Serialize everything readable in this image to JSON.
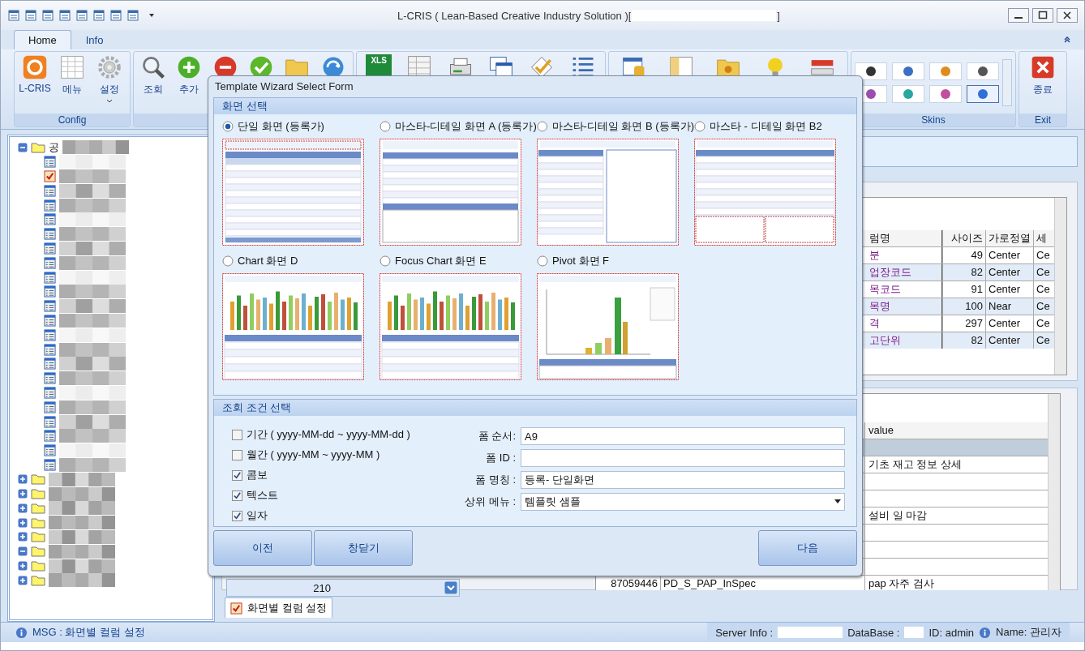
{
  "window": {
    "title": "L-CRIS ( Lean-Based Creative Industry Solution )[",
    "title_end": "]"
  },
  "tabs": [
    {
      "label": "Home",
      "selected": true
    },
    {
      "label": "Info",
      "selected": false
    }
  ],
  "ribbon": {
    "groups": [
      {
        "label": "Config",
        "buttons": [
          {
            "kind": "logo",
            "label": "L-CRIS"
          },
          {
            "kind": "grid",
            "label": "메뉴"
          },
          {
            "kind": "gear",
            "label": "설정",
            "caret": true
          }
        ]
      },
      {
        "buttons": [
          {
            "kind": "search",
            "label": "조회"
          },
          {
            "kind": "add",
            "label": "추가"
          },
          {
            "kind": "delete"
          },
          {
            "kind": "confirm"
          },
          {
            "kind": "folder"
          },
          {
            "kind": "refresh"
          }
        ]
      },
      {
        "buttons": [
          {
            "kind": "xls",
            "label": "XLS"
          },
          {
            "kind": "table"
          },
          {
            "kind": "printer"
          },
          {
            "kind": "windows"
          },
          {
            "kind": "check"
          },
          {
            "kind": "list"
          }
        ]
      },
      {
        "buttons": [
          {
            "kind": "window-db"
          },
          {
            "kind": "window2"
          },
          {
            "kind": "folder-star"
          },
          {
            "kind": "bulb"
          },
          {
            "kind": "toggle"
          }
        ]
      }
    ],
    "skins": {
      "label": "Skins",
      "items": [
        {
          "color": "#333333",
          "selected": false
        },
        {
          "color": "#3a6fc4",
          "selected": false
        },
        {
          "color": "#e08a1e",
          "selected": false
        },
        {
          "color": "#555555",
          "selected": false
        },
        {
          "color": "#9a4fb0",
          "selected": false
        },
        {
          "color": "#2aa6a0",
          "selected": false
        },
        {
          "color": "#c04fa0",
          "selected": false
        },
        {
          "color": "#2f6fd6",
          "selected": true
        }
      ]
    },
    "exit": {
      "label": "Exit",
      "button": "종료"
    }
  },
  "tree": [
    {
      "label": "공",
      "expanded": true,
      "children": [
        {
          "kind": "form"
        },
        {
          "kind": "checked"
        },
        {
          "kind": "form"
        },
        {
          "kind": "form"
        },
        {
          "kind": "form"
        },
        {
          "kind": "form"
        },
        {
          "kind": "form"
        },
        {
          "kind": "form"
        },
        {
          "kind": "form"
        },
        {
          "kind": "form"
        },
        {
          "kind": "form"
        },
        {
          "kind": "form"
        },
        {
          "kind": "form"
        },
        {
          "kind": "form"
        },
        {
          "kind": "form"
        },
        {
          "kind": "form"
        },
        {
          "kind": "form"
        },
        {
          "kind": "form"
        },
        {
          "kind": "form"
        },
        {
          "kind": "form"
        },
        {
          "kind": "form"
        },
        {
          "kind": "form"
        }
      ]
    },
    {
      "expanded": false
    },
    {
      "expanded": false
    },
    {
      "expanded": false
    },
    {
      "expanded": false
    },
    {
      "expanded": false
    },
    {
      "expanded": true
    },
    {
      "expanded": false
    },
    {
      "expanded": false
    }
  ],
  "column_grid": {
    "columns": [
      "럼명",
      "사이즈",
      "가로정열",
      "세"
    ],
    "rows": [
      {
        "cells": [
          "분",
          "49",
          "Center",
          "Ce"
        ],
        "selected": false
      },
      {
        "cells": [
          "업장코드",
          "82",
          "Center",
          "Ce"
        ],
        "selected": true
      },
      {
        "cells": [
          "목코드",
          "91",
          "Center",
          "Ce"
        ],
        "selected": false
      },
      {
        "cells": [
          "목명",
          "100",
          "Near",
          "Ce"
        ],
        "selected": true
      },
      {
        "cells": [
          "격",
          "297",
          "Center",
          "Ce"
        ],
        "selected": false
      },
      {
        "cells": [
          "고단위",
          "82",
          "Center",
          "Ce"
        ],
        "selected": true
      }
    ]
  },
  "value_grid": {
    "header": "value",
    "rows": [
      {
        "value": "",
        "selected": true
      },
      {
        "value": "기초 재고 정보 상세",
        "selected": false
      },
      {
        "value": "",
        "selected": false
      },
      {
        "value": "",
        "selected": false
      },
      {
        "value": "설비 일 마감",
        "selected": false
      },
      {
        "value": "",
        "selected": false
      },
      {
        "value": "",
        "selected": false
      },
      {
        "value": "",
        "selected": false
      }
    ],
    "last_row": {
      "number": "87059446",
      "name": "PD_S_PAP_InSpec",
      "value": "pap 자주 검사"
    }
  },
  "width_field": {
    "value": "210"
  },
  "bottom_tab": {
    "label": "화면별 컬럼 설정",
    "checked": true
  },
  "dialog": {
    "title": "Template Wizard Select Form",
    "screen_section": "화면 선택",
    "templates": [
      {
        "label": "단일 화면 (등록가)",
        "kind": "grid",
        "selected": true
      },
      {
        "label": "마스타-디테일 화면 A (등록가)",
        "kind": "master",
        "selected": false
      },
      {
        "label": "마스타-디테일 화면 B (등록가)",
        "kind": "split",
        "selected": false
      },
      {
        "label": "마스타 - 디테일 화면 B2",
        "kind": "split2",
        "selected": false
      },
      {
        "label": "Chart 화면 D",
        "kind": "chart",
        "selected": false
      },
      {
        "label": "Focus Chart 화면 E",
        "kind": "focus",
        "selected": false
      },
      {
        "label": "Pivot 화면 F",
        "kind": "pivot",
        "selected": false
      }
    ],
    "condition_section": "조회 조건 선택",
    "conditions": [
      {
        "label": "기간 ( yyyy-MM-dd ~ yyyy-MM-dd )",
        "checked": false
      },
      {
        "label": "월간 ( yyyy-MM ~ yyyy-MM )",
        "checked": false
      },
      {
        "label": "콤보",
        "checked": true
      },
      {
        "label": "텍스트",
        "checked": true
      },
      {
        "label": "일자",
        "checked": true
      }
    ],
    "fields": [
      {
        "label": "폼 순서:",
        "value": "A9",
        "kind": "text"
      },
      {
        "label": "폼 ID :",
        "kind": "text"
      },
      {
        "label": "폼 명칭 :",
        "value": "등록- 단일화면",
        "kind": "text"
      },
      {
        "label": "상위 메뉴 :",
        "value": "템플릿 샘플",
        "kind": "dropdown"
      }
    ],
    "buttons": {
      "back": "이전",
      "close": "창닫기",
      "next": "다음"
    }
  },
  "status_bar": {
    "message": "MSG : 화면별 컬럼 설정",
    "server": "Server Info :",
    "database": "DataBase :",
    "id": "ID: admin",
    "name": "Name: 관리자"
  }
}
